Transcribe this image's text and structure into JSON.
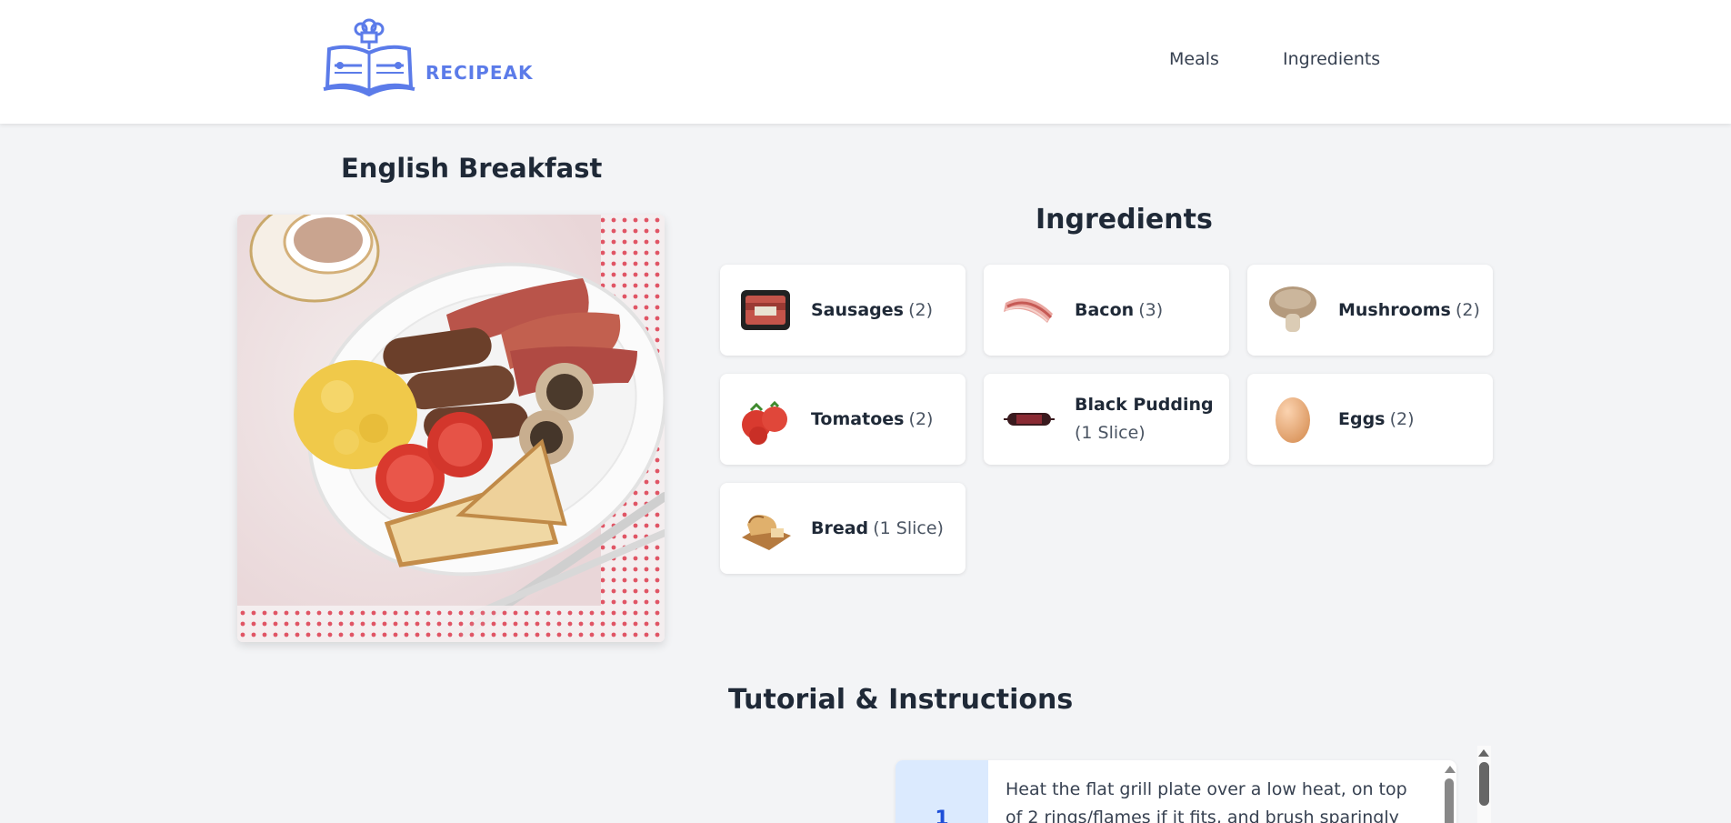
{
  "header": {
    "logo_text": "RECIPEAK",
    "nav": [
      {
        "label": "Meals"
      },
      {
        "label": "Ingredients"
      }
    ]
  },
  "meal": {
    "title": "English Breakfast"
  },
  "ingredients": {
    "heading": "Ingredients",
    "items": [
      {
        "name": "Sausages",
        "qty": "(2)",
        "icon": "sausages-icon"
      },
      {
        "name": "Bacon",
        "qty": "(3)",
        "icon": "bacon-icon"
      },
      {
        "name": "Mushrooms",
        "qty": "(2)",
        "icon": "mushroom-icon"
      },
      {
        "name": "Tomatoes",
        "qty": "(2)",
        "icon": "tomato-icon"
      },
      {
        "name": "Black Pudding",
        "qty": "(1 Slice)",
        "icon": "black-pudding-icon"
      },
      {
        "name": "Eggs",
        "qty": "(2)",
        "icon": "egg-icon"
      },
      {
        "name": "Bread",
        "qty": "(1 Slice)",
        "icon": "bread-icon"
      }
    ]
  },
  "tutorial": {
    "heading": "Tutorial & Instructions",
    "steps": [
      {
        "number": "1",
        "text": "Heat the flat grill plate over a low heat, on top of 2 rings/flames if it fits, and brush sparingly with light"
      }
    ]
  },
  "colors": {
    "brand": "#5b7be9",
    "background": "#f3f4f6",
    "step_badge": "#dbeafe",
    "step_number": "#1d4ed8"
  }
}
